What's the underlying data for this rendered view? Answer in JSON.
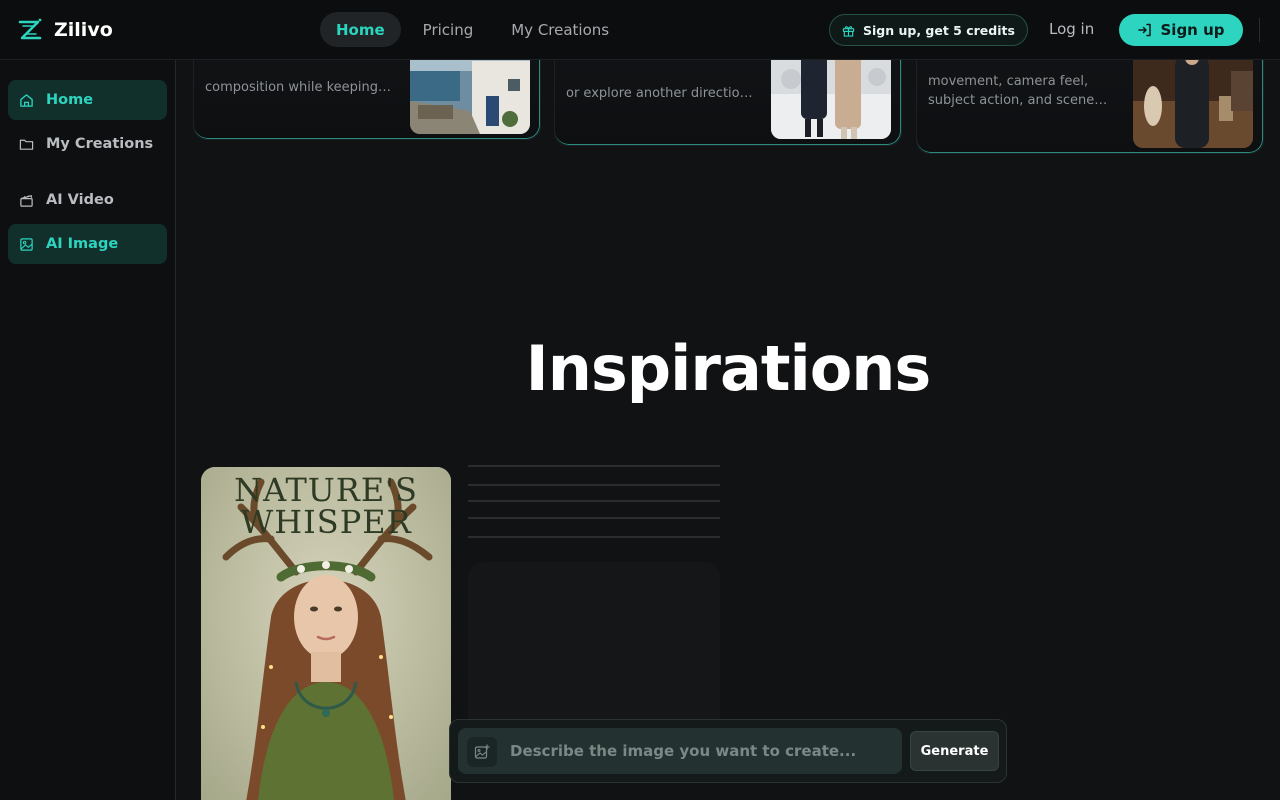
{
  "app": {
    "name": "Zilivo"
  },
  "nav": [
    {
      "label": "Home",
      "active": true
    },
    {
      "label": "Pricing",
      "active": false
    },
    {
      "label": "My Creations",
      "active": false
    }
  ],
  "header": {
    "credits_label": "Sign up, get 5 credits",
    "login_label": "Log in",
    "signup_label": "Sign up"
  },
  "sidebar": {
    "items": [
      {
        "label": "Home",
        "icon": "home-icon",
        "active": true
      },
      {
        "label": "My Creations",
        "icon": "folder-icon",
        "active": false
      },
      {
        "label": "AI Video",
        "icon": "video-icon",
        "active": false
      },
      {
        "label": "AI Image",
        "icon": "image-icon",
        "active": true
      }
    ]
  },
  "cards": [
    {
      "desc": "composition while keeping the details"
    },
    {
      "desc": "or explore another direction with it"
    },
    {
      "desc_line1": "movement, camera feel,",
      "desc_line2": "subject action, and scene…"
    }
  ],
  "main": {
    "section_title": "Inspirations"
  },
  "inspiration": {
    "headline_line1": "NATURE'S",
    "headline_line2": "WHISPER"
  },
  "prompt": {
    "placeholder": "Describe the image you want to create...",
    "generate_label": "Generate"
  },
  "colors": {
    "accent": "#2dd4bf",
    "background": "#111213",
    "sidebar": "#0d0f10"
  }
}
